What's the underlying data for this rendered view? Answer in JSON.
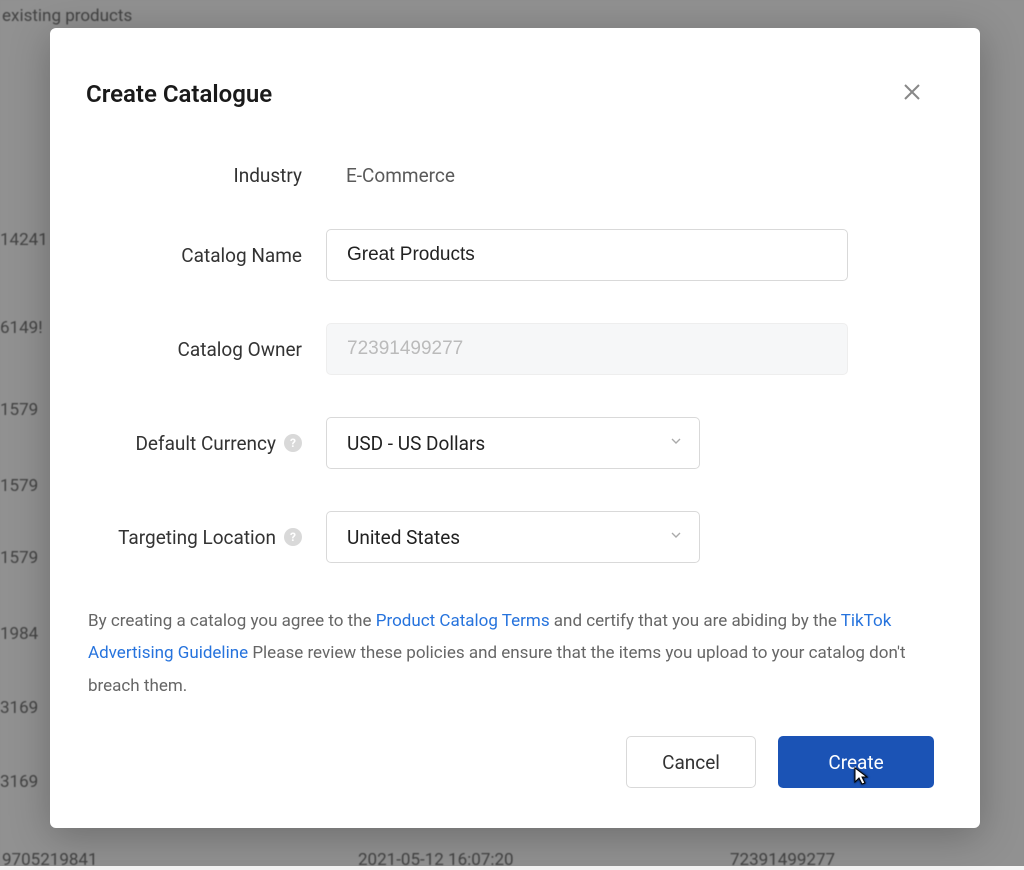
{
  "background": {
    "header_text": "existing products",
    "rows": [
      {
        "c1": "14241"
      },
      {
        "c1": "6149!"
      },
      {
        "c1": "1579"
      },
      {
        "c1": "1579"
      },
      {
        "c1": "1579"
      },
      {
        "c1": "1984"
      },
      {
        "c1": "3169"
      },
      {
        "c1": "3169"
      }
    ],
    "footer": {
      "c1": "9705219841",
      "c2": "2021-05-12 16:07:20",
      "c3": "72391499277"
    }
  },
  "modal": {
    "title": "Create Catalogue",
    "fields": {
      "industry": {
        "label": "Industry",
        "value": "E-Commerce"
      },
      "name": {
        "label": "Catalog Name",
        "value": "Great Products"
      },
      "owner": {
        "label": "Catalog Owner",
        "value": "72391499277"
      },
      "currency": {
        "label": "Default Currency",
        "value": "USD - US Dollars"
      },
      "location": {
        "label": "Targeting Location",
        "value": "United States"
      }
    },
    "disclaimer": {
      "p1": "By creating a catalog you agree to the ",
      "link1": "Product Catalog Terms",
      "p2": " and certify that you are abiding by the ",
      "link2": "TikTok Advertising Guideline",
      "p3": " Please review these policies and ensure that the items you upload to your catalog don't breach them."
    },
    "buttons": {
      "cancel": "Cancel",
      "create": "Create"
    }
  }
}
